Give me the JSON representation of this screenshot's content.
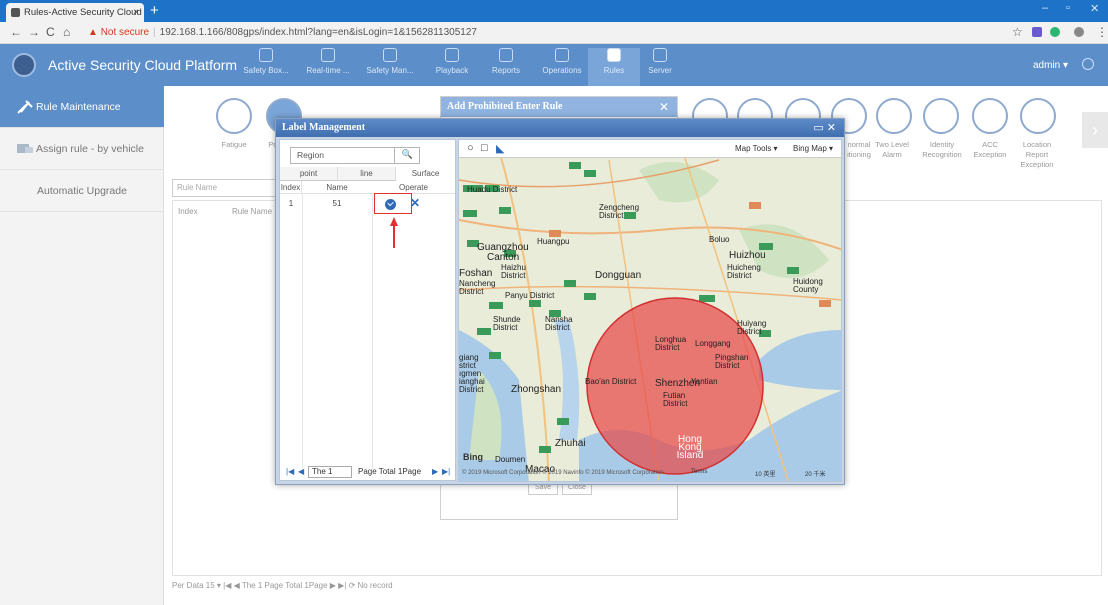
{
  "browser": {
    "tab_title": "Rules-Active Security Cloud Pl",
    "tab_close": "×",
    "new_tab": "+",
    "not_secure": "Not secure",
    "url": "192.168.1.166/808gps/index.html?lang=en&isLogin=1&1562811305127",
    "back": "←",
    "forward": "→",
    "reload": "C",
    "home": "⌂",
    "star": "☆",
    "menu": "⋮",
    "minimize": "–",
    "maximize": "▫",
    "close": "✕"
  },
  "header": {
    "title": "Active Security Cloud Platform",
    "nav": [
      {
        "label": "Safety Box..."
      },
      {
        "label": "Real-time ..."
      },
      {
        "label": "Safety Man..."
      },
      {
        "label": "Playback"
      },
      {
        "label": "Reports"
      },
      {
        "label": "Operations"
      },
      {
        "label": "Rules"
      },
      {
        "label": "Server"
      }
    ],
    "user": "admin ▾"
  },
  "sidebar": {
    "items": [
      {
        "label": "Rule Maintenance"
      },
      {
        "label": "Assign rule - by vehicle"
      },
      {
        "label": "Automatic Upgrade"
      }
    ]
  },
  "rule_types": {
    "left": [
      {
        "label": "Fatigue"
      },
      {
        "label": "Pr"
      }
    ],
    "right": [
      {
        "label": "normal itioning"
      },
      {
        "label": "Two Level Alarm"
      },
      {
        "label": "Identity Recognition"
      },
      {
        "label": "ACC Exception"
      },
      {
        "label": "Location Report Exception"
      }
    ]
  },
  "background_table": {
    "search_placeholder": "Rule Name",
    "col_index": "Index",
    "col_rule_name": "Rule Name",
    "footer": "Per Data  15  ▾   |◀  ◀   The  1     Page  Total 1Page   ▶  ▶|   ⟳   No record"
  },
  "add_rule_dialog": {
    "title": "Add   Prohibited Enter Rule",
    "close": "✕",
    "save": "Save",
    "close_btn": "Close"
  },
  "label_dialog": {
    "title": "Label Management",
    "region_placeholder": "Region",
    "search_icon": "🔍",
    "tabs": [
      "point",
      "line",
      "Surface"
    ],
    "columns": {
      "index": "Index",
      "name": "Name",
      "operate": "Operate"
    },
    "rows": [
      {
        "index": "1",
        "name": "51"
      }
    ],
    "delete_label": "✕",
    "pager": {
      "first": "|◀",
      "prev": "◀",
      "the": "The",
      "page_value": "1",
      "page_total": "Page  Total 1Page",
      "next": "▶",
      "last": "▶|"
    }
  },
  "map": {
    "tools_left": [
      "○",
      "□",
      "◣"
    ],
    "map_tools": "Map Tools ▾",
    "map_source": "Bing Map ▾",
    "labels": {
      "huadu": "Huadu District",
      "zengcheng": "Zengcheng District",
      "huangpu": "Huangpu",
      "guangzhou": "Guangzhou",
      "canton": "Canton",
      "haizhu": "Haizhu District",
      "boluo": "Boluo",
      "huizhou": "Huizhou",
      "huicheng": "Huicheng District",
      "huidong": "Huidong County",
      "foshan": "Foshan",
      "nancheng": "Nancheng District",
      "panyu": "Panyu District",
      "dongguan": "Dongguan",
      "shunde": "Shunde District",
      "nansha": "Nansha District",
      "huiyang": "Huiyang District",
      "longhua": "Longhua District",
      "longgang": "Longgang",
      "pingshan": "Pingshan District",
      "jiangmen": "giang strict ıgmen ianghai District",
      "zhongshan": "Zhongshan",
      "baoan": "Bao'an District",
      "shenzhen": "Shenzhen",
      "yantian": "Yantian",
      "futian": "Futian District",
      "zhuhai": "Zhuhai",
      "hongkong": "Hong Kong Island",
      "doumen": "Doumen",
      "macao": "Macao"
    },
    "bing": "Bing",
    "attribution": "© 2019 Microsoft Corporation  © 2019 Navinfo  © 2019 Microsoft Corporation",
    "terms": "Terms",
    "scale1": "10 英里",
    "scale2": "20 千米"
  }
}
